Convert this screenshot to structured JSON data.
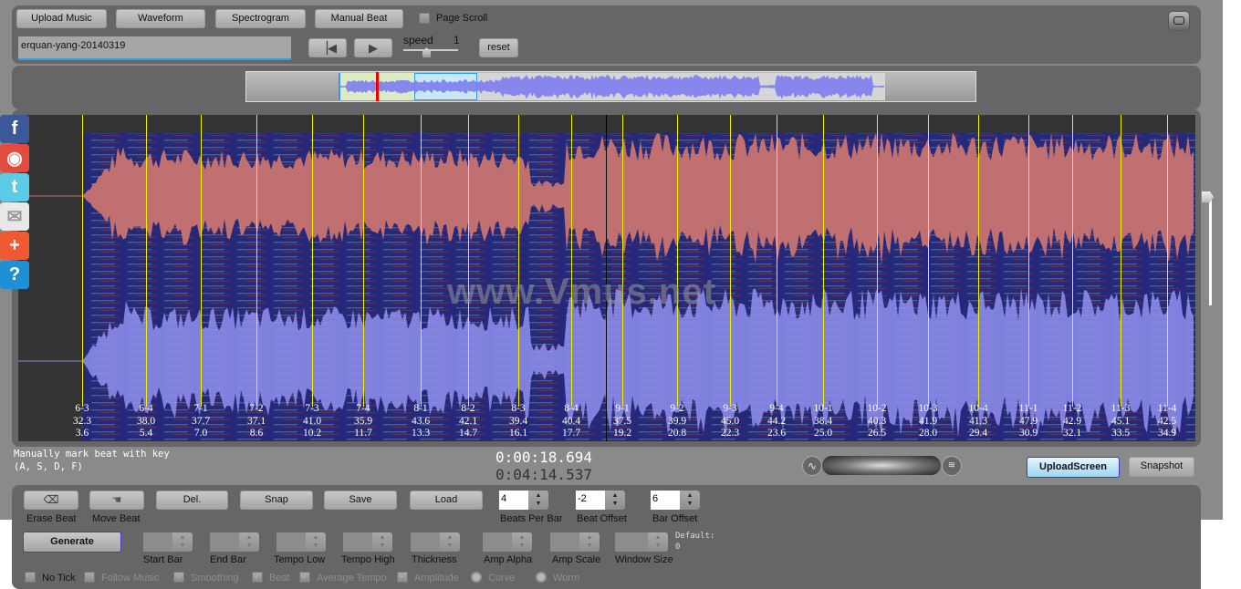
{
  "toolbar": {
    "upload_music": "Upload Music",
    "waveform": "Waveform",
    "spectrogram": "Spectrogram",
    "manual_beat": "Manual Beat",
    "page_scroll": "Page Scroll",
    "page_scroll_checked": false,
    "song_name": "erquan-yang-20140319",
    "speed_label": "speed",
    "speed_value": "1",
    "reset": "reset"
  },
  "overview": {
    "playhead_fraction": 0.21,
    "visible_window_fraction": [
      0.155,
      0.35
    ]
  },
  "social": [
    {
      "icon": "facebook-icon",
      "glyph": "f",
      "color": "#3b5998"
    },
    {
      "icon": "weibo-icon",
      "glyph": "◉",
      "color": "#e34b3c"
    },
    {
      "icon": "twitter-icon",
      "glyph": "t",
      "color": "#5ccbe6"
    },
    {
      "icon": "email-icon",
      "glyph": "✉",
      "color": "#e8e8e8"
    },
    {
      "icon": "add-share-icon",
      "glyph": "+",
      "color": "#f05a32"
    },
    {
      "icon": "help-icon",
      "glyph": "?",
      "color": "#1e90d6"
    }
  ],
  "watermark": "www.Vmus.net",
  "beats": [
    {
      "label": "6-3",
      "tempo": "32.3",
      "time": "3.6"
    },
    {
      "label": "6-4",
      "tempo": "38.0",
      "time": "5.4"
    },
    {
      "label": "7-1",
      "tempo": "37.7",
      "time": "7.0"
    },
    {
      "label": "7-2",
      "tempo": "37.1",
      "time": "8.6"
    },
    {
      "label": "7-3",
      "tempo": "41.0",
      "time": "10.2"
    },
    {
      "label": "7-4",
      "tempo": "35.9",
      "time": "11.7"
    },
    {
      "label": "8-1",
      "tempo": "43.6",
      "time": "13.3"
    },
    {
      "label": "8-2",
      "tempo": "42.1",
      "time": "14.7"
    },
    {
      "label": "8-3",
      "tempo": "39.4",
      "time": "16.1"
    },
    {
      "label": "8-4",
      "tempo": "40.4",
      "time": "17.7"
    },
    {
      "label": "9-1",
      "tempo": "37.5",
      "time": "19.2"
    },
    {
      "label": "9-2",
      "tempo": "39.9",
      "time": "20.8"
    },
    {
      "label": "9-3",
      "tempo": "45.0",
      "time": "22.3"
    },
    {
      "label": "9-4",
      "tempo": "44.2",
      "time": "23.6"
    },
    {
      "label": "10-1",
      "tempo": "38.4",
      "time": "25.0"
    },
    {
      "label": "10-2",
      "tempo": "40.3",
      "time": "26.5"
    },
    {
      "label": "10-3",
      "tempo": "41.9",
      "time": "28.0"
    },
    {
      "label": "10-4",
      "tempo": "41.3",
      "time": "29.4"
    },
    {
      "label": "11-1",
      "tempo": "47.9",
      "time": "30.9"
    },
    {
      "label": "11-2",
      "tempo": "42.9",
      "time": "32.1"
    },
    {
      "label": "11-3",
      "tempo": "45.1",
      "time": "33.5"
    },
    {
      "label": "11-4",
      "tempo": "42.5",
      "time": "34.9"
    }
  ],
  "status": {
    "hint_line1": "Manually mark beat with key",
    "hint_line2": "(A, S, D, F)",
    "current_time": "0:00:18.694",
    "total_time": "0:04:14.537",
    "upload_screen": "UploadScreen",
    "snapshot": "Snapshot"
  },
  "controls": {
    "erase_beat": "Erase Beat",
    "move_beat": "Move Beat",
    "del": "Del.",
    "snap": "Snap",
    "save": "Save",
    "load": "Load",
    "beats_per_bar_label": "Beats Per Bar",
    "beats_per_bar": "4",
    "beat_offset_label": "Beat Offset",
    "beat_offset": "-2",
    "bar_offset_label": "Bar Offset",
    "bar_offset": "6",
    "generate": "Generate",
    "start_bar": "Start Bar",
    "end_bar": "End Bar",
    "tempo_low": "Tempo Low",
    "tempo_high": "Tempo High",
    "thickness": "Thickness",
    "amp_alpha": "Amp Alpha",
    "amp_scale": "Amp Scale",
    "window_size": "Window Size",
    "default_label": "Default:",
    "default_value": "0"
  },
  "options": [
    {
      "label": "No Tick",
      "type": "checkbox",
      "checked": false,
      "enabled": true
    },
    {
      "label": "Follow Music",
      "type": "checkbox",
      "checked": false,
      "enabled": false
    },
    {
      "label": "Smoothing",
      "type": "checkbox",
      "checked": true,
      "enabled": false
    },
    {
      "label": "Beat",
      "type": "checkbox",
      "checked": true,
      "enabled": false
    },
    {
      "label": "Average Tempo",
      "type": "checkbox",
      "checked": true,
      "enabled": false
    },
    {
      "label": "Amplitude",
      "type": "checkbox",
      "checked": true,
      "enabled": false
    },
    {
      "label": "Curve",
      "type": "radio",
      "checked": true,
      "enabled": false
    },
    {
      "label": "Worm",
      "type": "radio",
      "checked": false,
      "enabled": false
    }
  ]
}
